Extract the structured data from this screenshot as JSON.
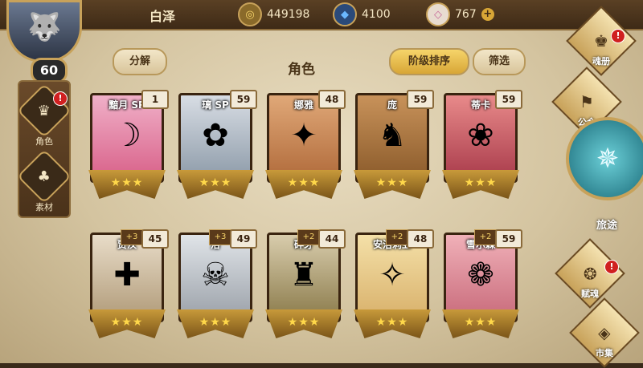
{
  "topbar": {
    "player_name": "白泽",
    "gold": "449198",
    "crystal": "4100",
    "gem": "767",
    "gem_plus": "+"
  },
  "player": {
    "level": "60"
  },
  "left_nav": [
    {
      "label": "角色",
      "icon": "character-icon"
    },
    {
      "label": "素材",
      "icon": "material-icon"
    }
  ],
  "header": {
    "decompose": "分解",
    "title": "角色",
    "sort": "阶级排序",
    "filter": "筛选"
  },
  "cards": [
    {
      "name": "黯月 SP",
      "level": "1",
      "bonus": "",
      "face": "☽",
      "color": "#d86088"
    },
    {
      "name": "璃 SP",
      "level": "59",
      "bonus": "",
      "face": "✿",
      "color": "#8c9aa8"
    },
    {
      "name": "娜雅",
      "level": "48",
      "bonus": "",
      "face": "✦",
      "color": "#b06a3a"
    },
    {
      "name": "庞",
      "level": "59",
      "bonus": "",
      "face": "♞",
      "color": "#8a5a2a"
    },
    {
      "name": "蒂卡",
      "level": "59",
      "bonus": "",
      "face": "❀",
      "color": "#a83a4a"
    },
    {
      "name": "贾汉",
      "level": "45",
      "bonus": "+3",
      "face": "✚",
      "color": "#b09a78"
    },
    {
      "name": "洛",
      "level": "49",
      "bonus": "+3",
      "face": "☠",
      "color": "#9aa0a8"
    },
    {
      "name": "碎牙",
      "level": "44",
      "bonus": "+2",
      "face": "♜",
      "color": "#8a7a4a"
    },
    {
      "name": "安洁莉亚",
      "level": "48",
      "bonus": "+2",
      "face": "✧",
      "color": "#d8b06a"
    },
    {
      "name": "雪尔森",
      "level": "59",
      "bonus": "+2",
      "face": "❁",
      "color": "#c86a7a"
    }
  ],
  "right_nav": {
    "soulbook": "魂册",
    "guild": "公会",
    "journey": "旅途",
    "talent": "赋魂",
    "market": "市集"
  },
  "colors": {
    "accent": "#c8a25a",
    "badge": "#d02020",
    "star": "#ffd84a"
  }
}
